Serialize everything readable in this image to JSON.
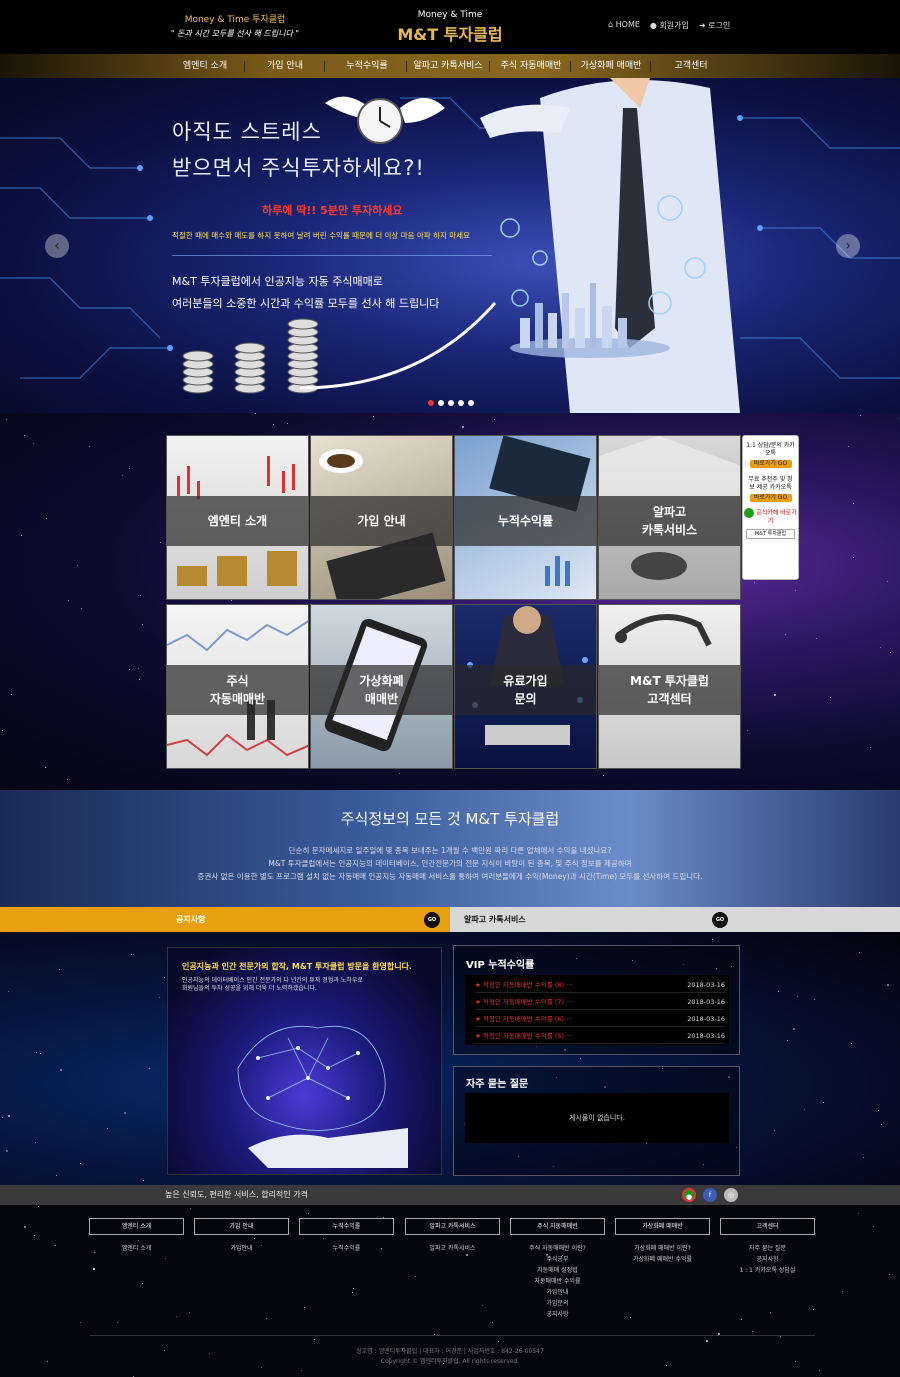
{
  "header": {
    "brand_left_title": "Money & Time 투자클럽",
    "brand_left_slogan": "\" 돈과 시간 모두를 선사 해 드립니다 \"",
    "logo_small": "Money & Time",
    "logo_big": "M&T 투자클럽",
    "util": [
      {
        "label": "HOME",
        "icon": "home-icon"
      },
      {
        "label": "회원가입",
        "icon": "user-icon"
      },
      {
        "label": "로그인",
        "icon": "login-icon"
      }
    ]
  },
  "nav": [
    "엠엔티 소개",
    "가입 안내",
    "누적수익률",
    "알파고 카톡서비스",
    "주식 자동매매반",
    "가상화폐 매매반",
    "고객센터"
  ],
  "hero": {
    "line1": "아직도 스트레스",
    "line2": "받으면서 주식투자하세요?!",
    "line3": "하루에 딱!! 5분만 투자하세요",
    "line4": "적절한 때에 매수와 매도를 하지 못하여 날려 버린 수익률 때문에 더 이상 마음 아파 하지 마세요",
    "line5": "M&T 투자클럽에서 인공지능 자동 주식매매로",
    "line6": "여러분들의 소중한 시간과 수익률 모두를 선사 해 드립니다",
    "prev_icon": "‹",
    "next_icon": "›"
  },
  "tiles": [
    {
      "label": "엠엔티 소개"
    },
    {
      "label": "가입 안내"
    },
    {
      "label": "누적수익률"
    },
    {
      "label": "알파고\n카톡서비스"
    },
    {
      "label": "주식\n자동매매반"
    },
    {
      "label": "가상화폐\n매매반"
    },
    {
      "label": "유료가입\n문의"
    },
    {
      "label": "M&T 투자클럽\n고객센터"
    }
  ],
  "side": {
    "s1": "1:1 상담/문의 카카오톡",
    "go1": "바로가기 GO",
    "s2": "무료 추천주 및 정보 제공 카카오톡",
    "go2": "바로가기 GO",
    "s3": "공식카페 바로가기",
    "s4": "M&T 투자클럽"
  },
  "intro": {
    "title": "주식정보의 모든 것 M&T 투자클럽",
    "p1": "단순히 문자메세지로 일주일에 몇 종목 보내주는 1개월 수 백만원 짜리 다른 업체에서 수익을 내셨나요?",
    "p2": "M&T 투자클럽에서는 인공지능의 데이터베이스, 인간전문가의 전문 지식이 바탕이 된 종목, 및 주식 정보를 제공하며",
    "p3": "증권사 없은 이용한 별도 프로그램 설치 없는 자동매매 인공지능 자동매매 서비스를 통하여 여러분들에게 수익(Money)과 시간(Time) 모두를 선사하여 드립니다."
  },
  "bars": {
    "left": "공지사항",
    "right": "알파고 카톡서비스",
    "go": "GO"
  },
  "news": {
    "title": "인공지능과 인간 전문가의 합작, M&T 투자클럽 방문을 환영합니다.",
    "desc1": "인공지능의 데이터베이스 인간 전문가의 다 년간의 투자 경험과 노하우로",
    "desc2": "회원님들의 투자 성공을 위해 더욱 더 노력하겠습니다."
  },
  "vip": {
    "title": "VIP 누적수익률",
    "rows": [
      {
        "t": "적정인 자동매매반 수익률 (8) ···",
        "d": "2018-03-16"
      },
      {
        "t": "적정인 자동매매반 수익률 (7) ···",
        "d": "2018-03-16"
      },
      {
        "t": "적정인 자동매매반 수익률 (6) ···",
        "d": "2018-03-16"
      },
      {
        "t": "적정인 자동매매반 수익률 (5) ···",
        "d": "2018-03-16"
      }
    ]
  },
  "faq": {
    "title": "자주 묻는 질문",
    "empty": "게시물이 없습니다."
  },
  "tagline": "높은 신뢰도, 편리한 서비스, 합리적인 가격",
  "footer": {
    "cols": [
      {
        "head": "엠엔티 소개",
        "items": [
          "엠엔티 소개"
        ]
      },
      {
        "head": "가입 안내",
        "items": [
          "가입안내"
        ]
      },
      {
        "head": "누적수익률",
        "items": [
          "누적수익률"
        ]
      },
      {
        "head": "알파고 카톡서비스",
        "items": [
          "알파고 카톡서비스"
        ]
      },
      {
        "head": "주식 자동매매반",
        "items": [
          "주식 자동매매반 이란?",
          "주식공부",
          "자동매매 설정법",
          "자동매매반 수익률",
          "가입안내",
          "가입문의",
          "공지사항"
        ]
      },
      {
        "head": "가상화폐 매매반",
        "items": [
          "가상화폐 매매반 이란?",
          "가상화폐 매매반 수익률"
        ]
      },
      {
        "head": "고객센터",
        "items": [
          "자주 묻는 질문",
          "공지사항",
          "1 : 1 카카오톡 상담실"
        ]
      }
    ],
    "copy1": "상호명 : 엠엔티투자클럽 | 대표자 : 어경준 | 사업자번호 : 842-26-00547",
    "copy2": "Copyright © 엠엔티투자클럽. All rights reserved."
  },
  "colors": {
    "gold": "#e8a010",
    "accent_red": "#e83030"
  }
}
